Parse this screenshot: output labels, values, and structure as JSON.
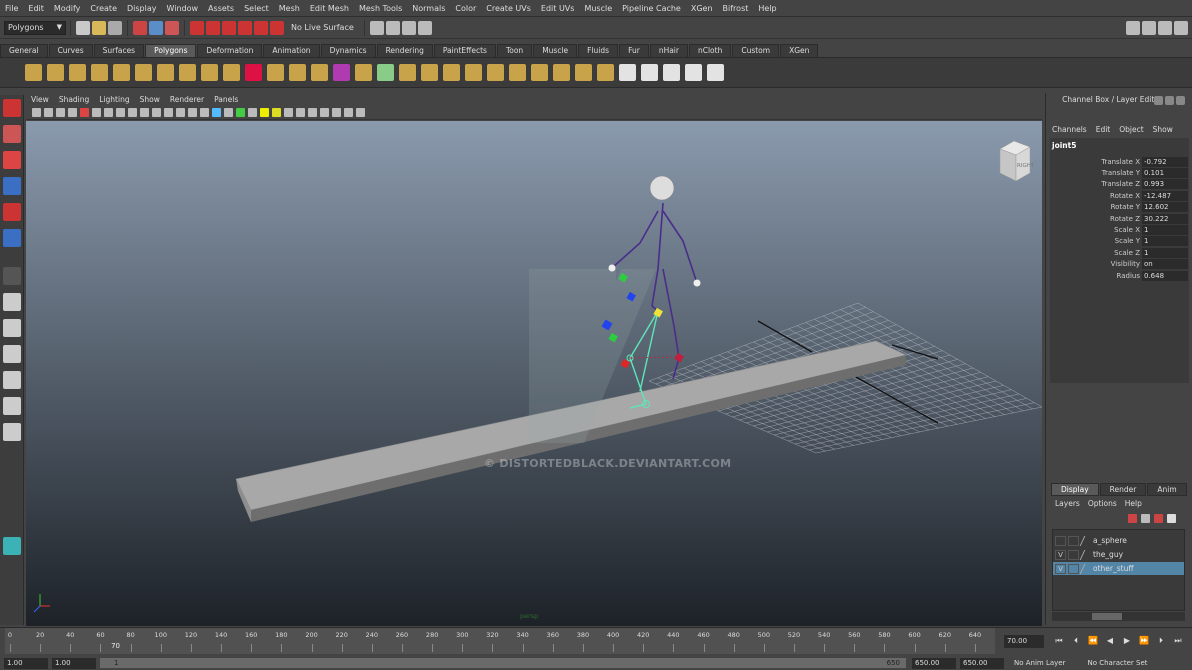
{
  "menubar": {
    "items": [
      "File",
      "Edit",
      "Modify",
      "Create",
      "Display",
      "Window",
      "Assets",
      "Select",
      "Mesh",
      "Edit Mesh",
      "Mesh Tools",
      "Normals",
      "Color",
      "Create UVs",
      "Edit UVs",
      "Muscle",
      "Pipeline Cache",
      "XGen",
      "Bifrost",
      "Help"
    ]
  },
  "statusline": {
    "menu_set": "Polygons",
    "live_surface": "No Live Surface"
  },
  "shelf": {
    "tabs": [
      "General",
      "Curves",
      "Surfaces",
      "Polygons",
      "Deformation",
      "Animation",
      "Dynamics",
      "Rendering",
      "PaintEffects",
      "Toon",
      "Muscle",
      "Fluids",
      "Fur",
      "nHair",
      "nCloth",
      "Custom",
      "XGen"
    ],
    "active_tab": "Polygons"
  },
  "viewport": {
    "menu": [
      "View",
      "Shading",
      "Lighting",
      "Show",
      "Renderer",
      "Panels"
    ],
    "viewcube_label": "RIGHT",
    "camera_label": "persp",
    "watermark": "© DISTORTEDBLACK.DEVIANTART.COM",
    "background_top": "#8a9aad",
    "background_bottom": "#1d2228"
  },
  "channel_box": {
    "title": "Channel Box / Layer Editor",
    "menu": [
      "Channels",
      "Edit",
      "Object",
      "Show"
    ],
    "object_name": "joint5",
    "channels": [
      {
        "label": "Translate X",
        "value": "-0.792"
      },
      {
        "label": "Translate Y",
        "value": "0.101"
      },
      {
        "label": "Translate Z",
        "value": "0.993"
      },
      {
        "label": "Rotate X",
        "value": "-12.487"
      },
      {
        "label": "Rotate Y",
        "value": "12.602"
      },
      {
        "label": "Rotate Z",
        "value": "30.222"
      },
      {
        "label": "Scale X",
        "value": "1"
      },
      {
        "label": "Scale Y",
        "value": "1"
      },
      {
        "label": "Scale Z",
        "value": "1"
      },
      {
        "label": "Visibility",
        "value": "on"
      },
      {
        "label": "Radius",
        "value": "0.648"
      }
    ]
  },
  "layer_editor": {
    "tabs": [
      "Display",
      "Render",
      "Anim"
    ],
    "active_tab": "Display",
    "menu": [
      "Layers",
      "Options",
      "Help"
    ],
    "layers": [
      {
        "visible": "",
        "name": "a_sphere",
        "selected": false
      },
      {
        "visible": "V",
        "name": "the_guy",
        "selected": false
      },
      {
        "visible": "V",
        "name": "other_stuff",
        "selected": true
      }
    ],
    "selected_color": "#5285a6"
  },
  "time_slider": {
    "ticks": [
      "0",
      "20",
      "40",
      "60",
      "80",
      "100",
      "120",
      "140",
      "160",
      "180",
      "200",
      "220",
      "240",
      "260",
      "280",
      "300",
      "320",
      "340",
      "360",
      "380",
      "400",
      "420",
      "440",
      "460",
      "480",
      "500",
      "520",
      "540",
      "560",
      "580",
      "600",
      "620",
      "640"
    ],
    "current_frame_marker": "70",
    "current_frame": "70.00",
    "max_frame": 650
  },
  "range_slider": {
    "start": "1.00",
    "start2": "1.00",
    "range_start": "1",
    "range_end": "650",
    "end": "650.00",
    "end2": "650.00",
    "anim_layer": "No Anim Layer",
    "char_set": "No Character Set"
  }
}
